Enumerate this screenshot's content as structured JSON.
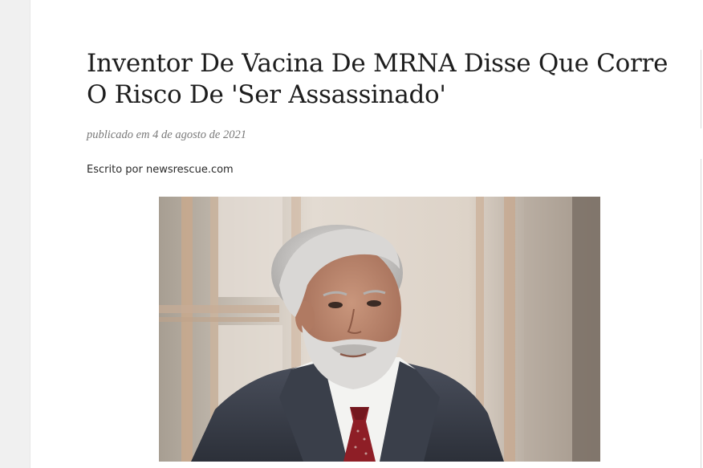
{
  "article": {
    "title": "Inventor De Vacina De MRNA Disse Que Corre O Risco De 'Ser Assassinado'",
    "published": "publicado em 4 de agosto de 2021",
    "author_line": "Escrito por newsrescue.com"
  },
  "colors": {
    "page_background": "#ffffff",
    "title_text": "#1e1e1e",
    "meta_text": "#7a7a7a",
    "tie": "#8e1e26",
    "suit": "#3f4450"
  }
}
